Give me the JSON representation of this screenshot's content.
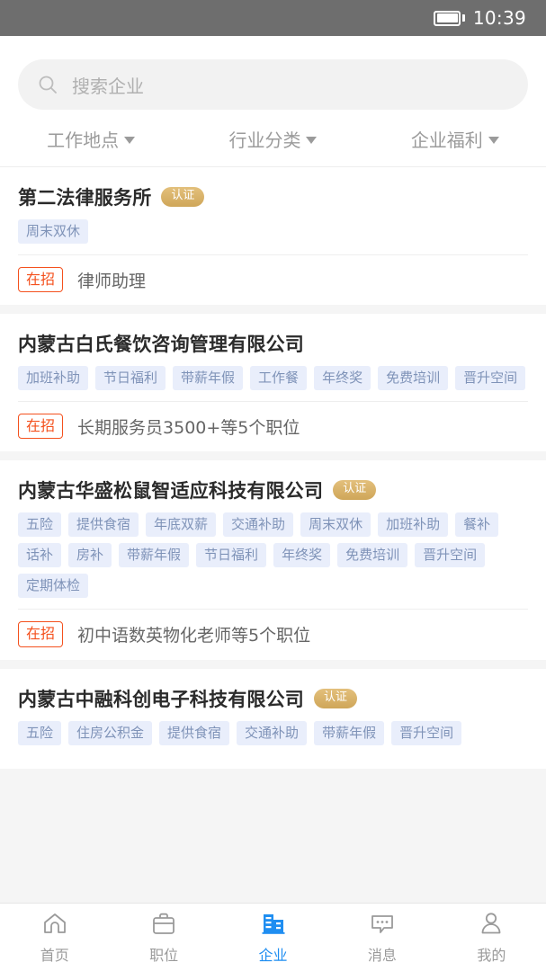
{
  "status_bar": {
    "time": "10:39",
    "battery_icon": "battery-full-icon"
  },
  "search": {
    "placeholder": "搜索企业",
    "value": "",
    "icon": "search-icon"
  },
  "filters": [
    {
      "label": "工作地点",
      "icon": "chevron-down-icon"
    },
    {
      "label": "行业分类",
      "icon": "chevron-down-icon"
    },
    {
      "label": "企业福利",
      "icon": "chevron-down-icon"
    }
  ],
  "labels": {
    "verified": "认证",
    "hiring": "在招"
  },
  "colors": {
    "accent": "#1f8ef1",
    "verified_badge": "#cfa659",
    "hiring_badge": "#f4511e",
    "tag_bg": "#e9eefb",
    "tag_text": "#7f93b8",
    "status_bar_bg": "#6e6e6e"
  },
  "companies": [
    {
      "name": "第二法律服务所",
      "verified": true,
      "tags": [
        "周末双休"
      ],
      "job": "律师助理"
    },
    {
      "name": "内蒙古白氏餐饮咨询管理有限公司",
      "verified": false,
      "tags": [
        "加班补助",
        "节日福利",
        "带薪年假",
        "工作餐",
        "年终奖",
        "免费培训",
        "晋升空间"
      ],
      "job": "长期服务员3500+等5个职位"
    },
    {
      "name": "内蒙古华盛松鼠智适应科技有限公司",
      "verified": true,
      "tags": [
        "五险",
        "提供食宿",
        "年底双薪",
        "交通补助",
        "周末双休",
        "加班补助",
        "餐补",
        "话补",
        "房补",
        "带薪年假",
        "节日福利",
        "年终奖",
        "免费培训",
        "晋升空间",
        "定期体检"
      ],
      "job": "初中语数英物化老师等5个职位"
    },
    {
      "name": "内蒙古中融科创电子科技有限公司",
      "verified": true,
      "tags": [
        "五险",
        "住房公积金",
        "提供食宿",
        "交通补助",
        "带薪年假",
        "晋升空间"
      ],
      "job": ""
    }
  ],
  "tabbar": [
    {
      "label": "首页",
      "icon": "home-icon",
      "active": false
    },
    {
      "label": "职位",
      "icon": "briefcase-icon",
      "active": false
    },
    {
      "label": "企业",
      "icon": "building-icon",
      "active": true
    },
    {
      "label": "消息",
      "icon": "chat-icon",
      "active": false
    },
    {
      "label": "我的",
      "icon": "person-icon",
      "active": false
    }
  ]
}
